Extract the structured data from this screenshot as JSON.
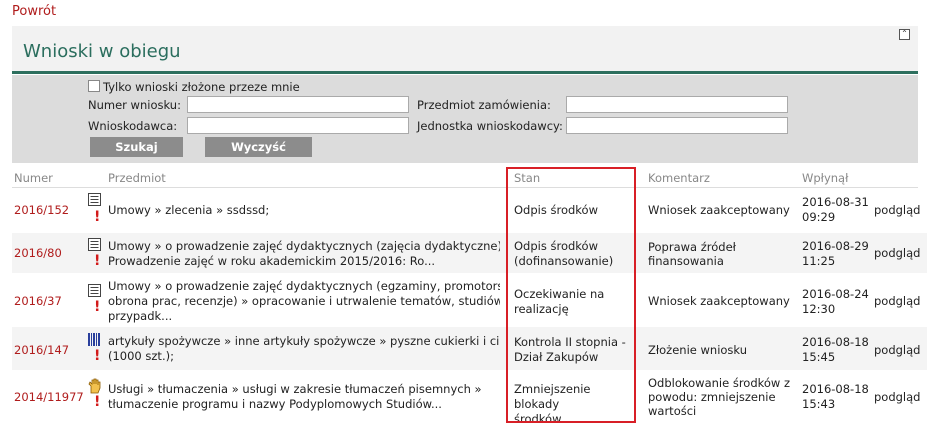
{
  "nav": {
    "back_label": "Powrót"
  },
  "panel": {
    "title": "Wnioski w obiegu"
  },
  "filters": {
    "only_mine_label": "Tylko wnioski złożone przeze mnie",
    "number_label": "Numer wniosku:",
    "subject_label": "Przedmiot zamówienia:",
    "applicant_label": "Wnioskodawca:",
    "unit_label": "Jednostka wnioskodawcy:",
    "search_label": "Szukaj",
    "clear_label": "Wyczyść"
  },
  "table": {
    "columns": [
      "Numer",
      "Przedmiot",
      "Stan",
      "Komentarz",
      "Wpłynął"
    ],
    "rows": [
      {
        "number": "2016/152",
        "icon": "document-list-icon",
        "subject": [
          "Umowy » zlecenia » ssdssd;"
        ],
        "state": [
          "Odpis środków"
        ],
        "comment": [
          "Wniosek zaakceptowany"
        ],
        "date": [
          "2016-08-31",
          "09:29"
        ],
        "action": "podgląd"
      },
      {
        "number": "2016/80",
        "icon": "document-list-icon",
        "subject": [
          "Umowy » o prowadzenie zajęć dydaktycznych (zajęcia dydaktyczne) »",
          "Prowadzenie zajęć w roku akademickim 2015/2016: Ro..."
        ],
        "state": [
          "Odpis środków",
          "(dofinansowanie)"
        ],
        "comment": [
          "Poprawa źródeł",
          "finansowania"
        ],
        "date": [
          "2016-08-29",
          "11:25"
        ],
        "action": "podgląd"
      },
      {
        "number": "2016/37",
        "icon": "document-list-icon",
        "subject": [
          "Umowy » o prowadzenie zajęć dydaktycznych (egzaminy, promotorstwo,",
          "obrona prac, recenzje) » opracowanie i utrwalenie tematów, studiów",
          "przypadk..."
        ],
        "state": [
          "Oczekiwanie na",
          "realizację"
        ],
        "comment": [
          "Wniosek zaakceptowany"
        ],
        "date": [
          "2016-08-24",
          "12:30"
        ],
        "action": "podgląd"
      },
      {
        "number": "2016/147",
        "icon": "barcode-icon",
        "subject": [
          "artykuły spożywcze » inne artykuły spożywcze » pyszne cukierki i ciastka",
          "(1000 szt.);"
        ],
        "state": [
          "Kontrola II stopnia -",
          "Dział Zakupów"
        ],
        "comment": [
          "Złożenie wniosku"
        ],
        "date": [
          "2016-08-18",
          "15:45"
        ],
        "action": "podgląd"
      },
      {
        "number": "2014/11977",
        "icon": "hand-icon",
        "subject": [
          "Usługi » tłumaczenia » usługi w zakresie tłumaczeń pisemnych »",
          "tłumaczenie programu i nazwy Podyplomowych Studiów..."
        ],
        "state": [
          "Zmniejszenie blokady",
          "środków"
        ],
        "comment": [
          "Odblokowanie środków z",
          "powodu: zmniejszenie",
          "wartości"
        ],
        "date": [
          "2016-08-18",
          "15:43"
        ],
        "action": "podgląd"
      }
    ]
  },
  "colors": {
    "link": "#b01c1c",
    "accent": "#2d6f5e",
    "highlight": "#d81f26",
    "warning": "#d21a1a"
  }
}
